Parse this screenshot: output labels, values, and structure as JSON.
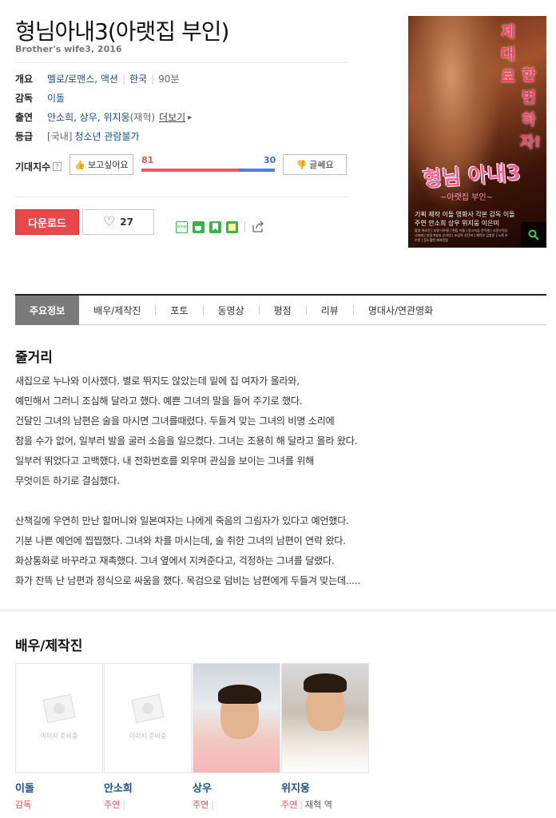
{
  "movie": {
    "title": "형님아내3(아랫집 부인)",
    "subtitle": "Brother's wife3, 2016"
  },
  "info": {
    "overview_label": "개요",
    "genre": "멜로/로맨스, 액션",
    "country": "한국",
    "runtime": "90분",
    "director_label": "감독",
    "director": "이돌",
    "cast_label": "출연",
    "cast_names": "안소희, 상우, 위지웅",
    "cast_role_note": "(재혁)",
    "more_label": "더보기",
    "rating_label": "등급",
    "rating_region": "[국내]",
    "rating": "청소년 관람불가"
  },
  "expectation": {
    "label": "기대지수",
    "want_label": "보고싶어요",
    "want_count": "81",
    "dislike_label": "글쎄요",
    "dislike_count": "30",
    "want_fraction": 0.73
  },
  "actions": {
    "download_label": "다운로드",
    "like_count": "27",
    "share_blog_label": "blog"
  },
  "poster": {
    "vertical_text_1": "제대로",
    "vertical_text_2": "한번하자!",
    "title_text": "형님 아내3",
    "sub_text": "~아랫집 부인~",
    "credit_1": "기획 제작 이돌 영화사   각본 감독 이돌",
    "credit_2": "주연 안소희 상우 위지웅 이은미",
    "credit_small": "촬영 여오진 | 조명 이수용 | 편집 이돌 | 동시녹음 문득열 | 사운드믹싱 나미래 | 분장 K뷰티 신가연 | 조감독 신단비 | 제작부 김봉준 | 노래 조수민 | 장소협찬 레저민랑"
  },
  "tabs": [
    "주요정보",
    "배우/제작진",
    "포토",
    "동영상",
    "평점",
    "리뷰",
    "명대사/연관영화"
  ],
  "synopsis": {
    "title": "줄거리",
    "lines": [
      "새집으로 누나와 이사했다. 별로 뛰지도 않았는데 밑에 집 여자가 올라와,",
      "  예민해서 그러니 조심해 달라고 했다. 예쁜 그녀의 말을 들어 주기로 했다.",
      "  건달인 그녀의 남편은 술을 마시면 그녀를때렸다. 두들겨 맞는 그녀의 비명 소리에",
      "  참을 수가 없어, 일부러 발을 굴러 소음을 일으켰다. 그녀는 조용히 해 달라고 올라 왔다.",
      "  일부러 뛰었다고 고백했다. 내 전화번호를 외우며 관심을 보이는 그녀를 위해",
      "  무엇이든 하기로 결심했다.",
      "",
      "  산책길에 우연히 만난 할머니와 일본여자는 나에게 죽음의 그림자가 있다고 예언했다.",
      "  기분 나쁜 예언에 찝찝했다. 그녀와 차를 마시는데, 술 취한 그녀의 남편이 연락 왔다.",
      "  화상통화로 바꾸라고 재촉했다. 그녀 옆에서 지켜준다고, 걱정하는 그녀를 달랬다.",
      "  화가 잔뜩 난 남편과 정식으로 싸움을 했다. 목검으로 덤비는 남편에게 두들겨 맞는데....."
    ]
  },
  "cast_section": {
    "title": "배우/제작진",
    "no_image_text": "이미지 준비중",
    "people": [
      {
        "name": "이돌",
        "role": "감독",
        "character": ""
      },
      {
        "name": "안소희",
        "role": "주연",
        "character": ""
      },
      {
        "name": "상우",
        "role": "주연",
        "character": ""
      },
      {
        "name": "위지웅",
        "role": "주연",
        "character": "재혁 역"
      }
    ]
  }
}
